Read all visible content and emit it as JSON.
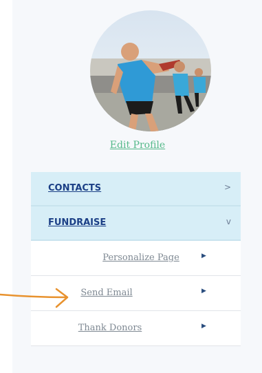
{
  "profile": {
    "edit_link": "Edit Profile"
  },
  "menu": {
    "items": [
      {
        "label": "CONTACTS",
        "chevron": ">"
      },
      {
        "label": "FUNDRAISE",
        "chevron": "v"
      }
    ],
    "subitems": [
      {
        "label": "Personalize Page",
        "arrow": "▶"
      },
      {
        "label": "Send Email",
        "arrow": "▶"
      },
      {
        "label": "Thank Donors",
        "arrow": "▶"
      }
    ]
  },
  "colors": {
    "accent_link": "#55b98a",
    "menu_bg": "#d7eef7",
    "menu_text": "#1b3f86",
    "annotation_arrow": "#e8922e"
  }
}
